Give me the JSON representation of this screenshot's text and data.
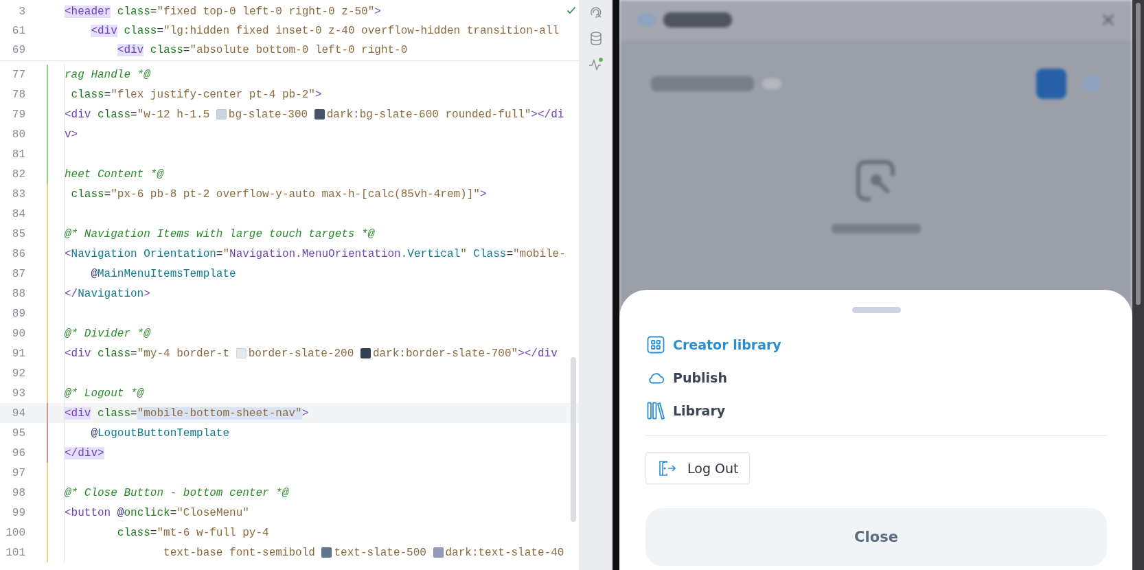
{
  "editor": {
    "sticky_lines": [
      {
        "number": "3",
        "tokens": [
          {
            "kind": "tag",
            "text": "<header",
            "highlighted": true
          },
          {
            "kind": "attr",
            "text": " class"
          },
          {
            "kind": "punct",
            "text": "="
          },
          {
            "kind": "string",
            "text": "\"fixed top-0 left-0 right-0 z-50\""
          },
          {
            "kind": "tag",
            "text": ">"
          }
        ]
      },
      {
        "number": "61",
        "tokens": [
          {
            "kind": "tag",
            "text": "    <div",
            "highlighted": true
          },
          {
            "kind": "attr",
            "text": " class"
          },
          {
            "kind": "punct",
            "text": "="
          },
          {
            "kind": "string",
            "text": "\"lg:hidden fixed inset-0 z-40 overflow-hidden transition-all"
          }
        ]
      },
      {
        "number": "69",
        "tokens": [
          {
            "kind": "tag",
            "text": "        <div",
            "highlighted": true
          },
          {
            "kind": "attr",
            "text": " class"
          },
          {
            "kind": "punct",
            "text": "="
          },
          {
            "kind": "string",
            "text": "\"absolute bottom-0 left-0 right-0"
          }
        ]
      }
    ],
    "lines": [
      {
        "number": "77",
        "color": "#8fd18f",
        "current": false,
        "tokens": [
          {
            "kind": "comment",
            "text": "rag Handle *@"
          }
        ]
      },
      {
        "number": "78",
        "color": "#8fd18f",
        "current": false,
        "tokens": [
          {
            "kind": "attr",
            "text": " class"
          },
          {
            "kind": "punct",
            "text": "="
          },
          {
            "kind": "string",
            "text": "\"flex justify-center pt-4 pb-2\""
          },
          {
            "kind": "tag",
            "text": ">"
          }
        ]
      },
      {
        "number": "79",
        "color": "#8fd18f",
        "current": false,
        "tokens": [
          {
            "kind": "tag",
            "text": "<div"
          },
          {
            "kind": "attr",
            "text": " class"
          },
          {
            "kind": "punct",
            "text": "="
          },
          {
            "kind": "string",
            "text": "\"w-12 h-1.5 "
          },
          {
            "kind": "swatch",
            "color": "#cbd5e1"
          },
          {
            "kind": "string",
            "text": "bg-slate-300 "
          },
          {
            "kind": "swatch",
            "color": "#475569"
          },
          {
            "kind": "string",
            "text": "dark:bg-slate-600 rounded-full\""
          },
          {
            "kind": "tag",
            "text": "></di"
          }
        ]
      },
      {
        "number": "80",
        "color": "#8fd18f",
        "current": false,
        "tokens": [
          {
            "kind": "tag",
            "text": "v>"
          }
        ]
      },
      {
        "number": "81",
        "color": "#8fd18f",
        "current": false
      },
      {
        "number": "82",
        "color": "#8fd18f",
        "current": false,
        "tokens": [
          {
            "kind": "comment",
            "text": "heet Content *@"
          }
        ]
      },
      {
        "number": "83",
        "color": "#e6d58a",
        "current": false,
        "tokens": [
          {
            "kind": "attr",
            "text": " class"
          },
          {
            "kind": "punct",
            "text": "="
          },
          {
            "kind": "string",
            "text": "\"px-6 pb-8 pt-2 overflow-y-auto max-h-[calc(85vh-4rem)]\""
          },
          {
            "kind": "tag",
            "text": ">"
          }
        ]
      },
      {
        "number": "84",
        "color": "#e6d58a",
        "current": false
      },
      {
        "number": "85",
        "color": "#e6d58a",
        "current": false,
        "tokens": [
          {
            "kind": "comment",
            "text": "@* Navigation Items with large touch targets *@"
          }
        ]
      },
      {
        "number": "86",
        "color": "#e6d58a",
        "current": false,
        "tokens": [
          {
            "kind": "tag",
            "text": "<"
          },
          {
            "kind": "component",
            "text": "Navigation"
          },
          {
            "kind": "component",
            "text": " Orientation"
          },
          {
            "kind": "punct",
            "text": "="
          },
          {
            "kind": "string",
            "text": "\""
          },
          {
            "kind": "enum",
            "text": "Navigation.MenuOrientation"
          },
          {
            "kind": "component",
            "text": ".Vertical"
          },
          {
            "kind": "string",
            "text": "\""
          },
          {
            "kind": "component",
            "text": " Class"
          },
          {
            "kind": "punct",
            "text": "="
          },
          {
            "kind": "string",
            "text": "\"mobile-"
          }
        ]
      },
      {
        "number": "87",
        "color": "#e6d58a",
        "current": false,
        "tokens": [
          {
            "kind": "razor",
            "text": "    @"
          },
          {
            "kind": "member",
            "text": "MainMenuItemsTemplate"
          }
        ]
      },
      {
        "number": "88",
        "color": "#e6d58a",
        "current": false,
        "tokens": [
          {
            "kind": "tag",
            "text": "</"
          },
          {
            "kind": "component",
            "text": "Navigation"
          },
          {
            "kind": "tag",
            "text": ">"
          }
        ]
      },
      {
        "number": "89",
        "color": "#e6d58a",
        "current": false
      },
      {
        "number": "90",
        "color": "#e6d58a",
        "current": false,
        "tokens": [
          {
            "kind": "comment",
            "text": "@* Divider *@"
          }
        ]
      },
      {
        "number": "91",
        "color": "#e6d58a",
        "current": false,
        "tokens": [
          {
            "kind": "tag",
            "text": "<div"
          },
          {
            "kind": "attr",
            "text": " class"
          },
          {
            "kind": "punct",
            "text": "="
          },
          {
            "kind": "string",
            "text": "\"my-4 border-t "
          },
          {
            "kind": "swatch",
            "color": "#e2e8f0"
          },
          {
            "kind": "string",
            "text": "border-slate-200 "
          },
          {
            "kind": "swatch",
            "color": "#334155"
          },
          {
            "kind": "string",
            "text": "dark:border-slate-700\""
          },
          {
            "kind": "tag",
            "text": "></div"
          }
        ]
      },
      {
        "number": "92",
        "color": "#e6d58a",
        "current": false
      },
      {
        "number": "93",
        "color": "#e6d58a",
        "current": false,
        "tokens": [
          {
            "kind": "comment",
            "text": "@* Logout *@"
          }
        ]
      },
      {
        "number": "94",
        "color": "#c69a8f",
        "current": true,
        "tokens": [
          {
            "kind": "tag",
            "text": "<div",
            "highlighted": true
          },
          {
            "kind": "attr",
            "text": " class"
          },
          {
            "kind": "punct",
            "text": "="
          },
          {
            "kind": "string",
            "text": "\"mobile-bottom-sheet-nav\"",
            "highlighted": true
          },
          {
            "kind": "tag",
            "text": ">"
          }
        ]
      },
      {
        "number": "95",
        "color": "#c69a8f",
        "current": false,
        "tokens": [
          {
            "kind": "razor",
            "text": "    @"
          },
          {
            "kind": "member",
            "text": "LogoutButtonTemplate"
          }
        ]
      },
      {
        "number": "96",
        "color": "#c69a8f",
        "current": false,
        "tokens": [
          {
            "kind": "tag",
            "text": "</div>",
            "highlighted": true
          }
        ]
      },
      {
        "number": "97",
        "color": "#e6d58a",
        "current": false
      },
      {
        "number": "98",
        "color": "#e6d58a",
        "current": false,
        "tokens": [
          {
            "kind": "comment",
            "text": "@* Close Button - bottom center *@"
          }
        ]
      },
      {
        "number": "99",
        "color": "#e6d58a",
        "current": false,
        "tokens": [
          {
            "kind": "tag",
            "text": "<button"
          },
          {
            "kind": "razor",
            "text": " @"
          },
          {
            "kind": "attr",
            "text": "onclick"
          },
          {
            "kind": "punct",
            "text": "="
          },
          {
            "kind": "string",
            "text": "\"CloseMenu\""
          }
        ]
      },
      {
        "number": "100",
        "color": "#e6d58a",
        "current": false,
        "tokens": [
          {
            "kind": "attr",
            "text": "        class"
          },
          {
            "kind": "punct",
            "text": "="
          },
          {
            "kind": "string",
            "text": "\"mt-6 w-full py-4"
          }
        ]
      },
      {
        "number": "101",
        "color": "#e6d58a",
        "current": false,
        "tokens": [
          {
            "kind": "string",
            "text": "               text-base font-semibold "
          },
          {
            "kind": "swatch",
            "color": "#5f7690"
          },
          {
            "kind": "string",
            "text": "text-slate-500 "
          },
          {
            "kind": "swatch",
            "color": "#929bbb"
          },
          {
            "kind": "string",
            "text": "dark:text-slate-40"
          }
        ]
      }
    ]
  },
  "preview": {
    "sheet": {
      "nav_items": [
        {
          "label": "Creator library",
          "selected": true
        },
        {
          "label": "Publish",
          "selected": false
        },
        {
          "label": "Library",
          "selected": false
        }
      ],
      "logout_label": "Log Out",
      "close_label": "Close"
    }
  }
}
